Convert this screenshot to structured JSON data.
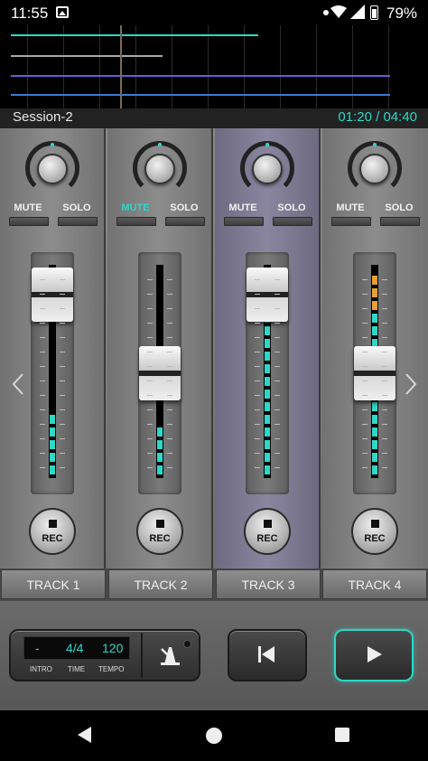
{
  "status_bar": {
    "time": "11:55",
    "battery": "79%",
    "icons": [
      "image-icon",
      "dot-icon",
      "wifi-icon",
      "signal-icon",
      "battery-icon"
    ]
  },
  "timeline": {
    "lane_colors": [
      "#2cd8c8",
      "#a8a8a8",
      "#6a5ad8",
      "#3a7ad8"
    ]
  },
  "session": {
    "name": "Session-2",
    "position": "01:20 / 04:40"
  },
  "tracks": [
    {
      "label": "TRACK 1",
      "mute_label": "MUTE",
      "solo_label": "SOLO",
      "rec_label": "REC",
      "mute_active": false,
      "selected": false,
      "fader_level": 0.92,
      "meter_level": 0.3
    },
    {
      "label": "TRACK 2",
      "mute_label": "MUTE",
      "solo_label": "SOLO",
      "rec_label": "REC",
      "mute_active": true,
      "selected": false,
      "fader_level": 0.5,
      "meter_level": 0.25
    },
    {
      "label": "TRACK 3",
      "mute_label": "MUTE",
      "solo_label": "SOLO",
      "rec_label": "REC",
      "mute_active": false,
      "selected": true,
      "fader_level": 0.92,
      "meter_level": 0.8
    },
    {
      "label": "TRACK 4",
      "mute_label": "MUTE",
      "solo_label": "SOLO",
      "rec_label": "REC",
      "mute_active": false,
      "selected": false,
      "fader_level": 0.5,
      "meter_level": 0.98
    }
  ],
  "transport": {
    "intro_value": "-",
    "time_value": "4/4",
    "tempo_value": "120",
    "intro_label": "INTRO",
    "time_label": "TIME",
    "tempo_label": "TEMPO"
  },
  "colors": {
    "accent": "#2cd8c8",
    "meter_peak": "#e8a030"
  }
}
